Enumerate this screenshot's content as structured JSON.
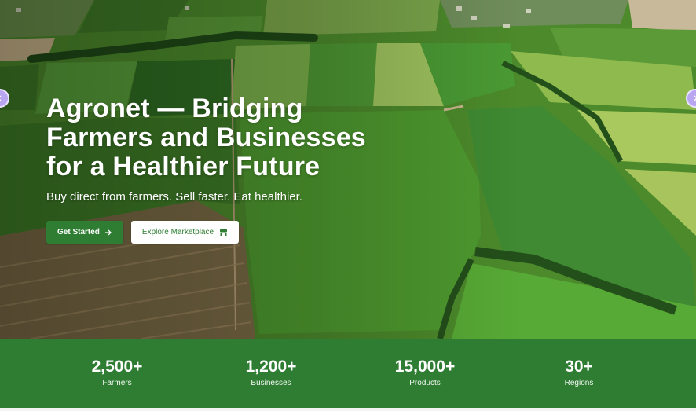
{
  "hero": {
    "title_lines": [
      "Agronet — Bridging",
      "Farmers and Businesses",
      "for a Healthier Future"
    ],
    "subtitle": "Buy direct from farmers. Sell faster. Eat healthier.",
    "primary_cta": "Get Started",
    "primary_cta_icon": "arrow-right-icon",
    "secondary_cta": "Explore Marketplace",
    "secondary_cta_icon": "store-icon"
  },
  "stats": [
    {
      "value": "2,500+",
      "label": "Farmers"
    },
    {
      "value": "1,200+",
      "label": "Businesses"
    },
    {
      "value": "15,000+",
      "label": "Products"
    },
    {
      "value": "30+",
      "label": "Regions"
    }
  ],
  "colors": {
    "brand_green": "#2e7d32",
    "carousel_nav": "#b8a6f0"
  }
}
